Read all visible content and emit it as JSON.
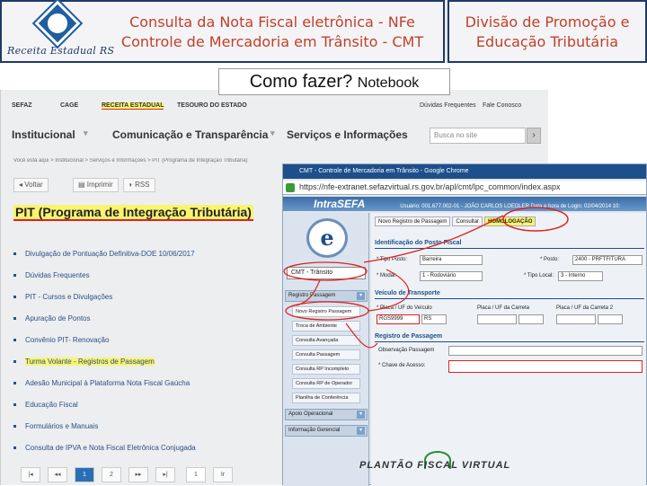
{
  "header": {
    "logo_text": "Receita Estadual RS",
    "title_line1": "Consulta da Nota Fiscal eletrônica - NFe",
    "title_line2": "Controle de Mercadoria em Trânsito - CMT",
    "right_line1": "Divisão de Promoção e",
    "right_line2": "Educação Tributária"
  },
  "howto": {
    "main": "Como fazer?",
    "sub": "Notebook"
  },
  "site": {
    "topnav": [
      "SEFAZ",
      "CAGE",
      "RECEITA ESTADUAL",
      "TESOURO DO ESTADO",
      "Dúvidas Frequentes",
      "Fale Conosco"
    ],
    "nav": [
      "Institucional",
      "Comunicação e Transparência",
      "Serviços e Informações"
    ],
    "search_placeholder": "Busca no site",
    "search_button": "›",
    "breadcrumb": "Você está aqui > Institucional > Serviços e Informações > PIT (Programa de Integração Tributária)",
    "tools": [
      "Voltar",
      "Imprimir",
      "RSS"
    ],
    "page_title": "PIT (Programa de Integração Tributária)",
    "links": [
      "Divulgação de Pontuação Definitiva-DOE 10/06/2017",
      "Dúvidas Frequentes",
      "PIT - Cursos e Divulgações",
      "Apuração de Pontos",
      "Convênio PIT- Renovação",
      "Turma Volante - Registros de Passagem",
      "Adesão Municipal à Plataforma Nota Fiscal Gaúcha",
      "Educação Fiscal",
      "Formulários e Manuais",
      "Consulta de IPVA e Nota Fiscal Eletrônica Conjugada"
    ],
    "pager": [
      "|◂",
      "◂◂",
      "1",
      "2",
      "▸▸",
      "▸|",
      "1",
      "Ir"
    ]
  },
  "browser": {
    "title": "CMT - Controle de Mercadoria em Trânsito - Google Chrome",
    "url": "https://nfe-extranet.sefazvirtual.rs.gov.br/apl/cmt/lpc_common/index.aspx",
    "brand": "IntraSEFA",
    "session_info": "Usuário: 001.677.002-01 - JOÃO CARLOS LOEDLER    Data e hora de Login: 02/04/2014 10:",
    "tabs": [
      "Novo Registro de Passagem",
      "Consultar",
      "HOMOLOGAÇÃO"
    ],
    "nfe_logo": "e",
    "system_select": "CMT - Trânsito",
    "menu": {
      "header": "Registro Passagem",
      "items": [
        "Novo Registro Passagem",
        "Troca de Ambiente",
        "Consulta Avançada",
        "Consulta Passagem",
        "Consulta RP Incompleto",
        "Consulta RP de Operador",
        "Planilha de Conferência"
      ],
      "footer1": "Apoio Operacional",
      "footer2": "Informação Gerencial"
    },
    "form": {
      "sec1": "Identificação do Posto Fiscal",
      "tipo_posto_label": "* Tipo Posto:",
      "tipo_posto_value": "Barreira",
      "posto_label": "* Posto:",
      "posto_value": "2400 - PRFTFITURA",
      "modal_label": "* Modal:",
      "modal_value": "1 - Rodoviário",
      "tipo_local_label": "* Tipo Local:",
      "tipo_local_value": "3 - Interno",
      "sec2": "Veículo de Transporte",
      "placa_label": "* Placa / UF do Veículo",
      "placa1_label": "Placa / UF da Carreta",
      "placa2_label": "Placa / UF da Carreta 2",
      "placa_value": "RGS9999",
      "uf_value": "RS",
      "sec3": "Registro de Passagem",
      "obs_label": "Observação Passagem",
      "chave_label": "* Chave de Acesso:"
    }
  },
  "footer": {
    "brand": "PLANTÃO FISCAL VIRTUAL"
  },
  "colors": {
    "highlight": "#f8f470",
    "annotation": "#e02020",
    "title_red": "#c0402a",
    "navy": "#1f3a68"
  }
}
